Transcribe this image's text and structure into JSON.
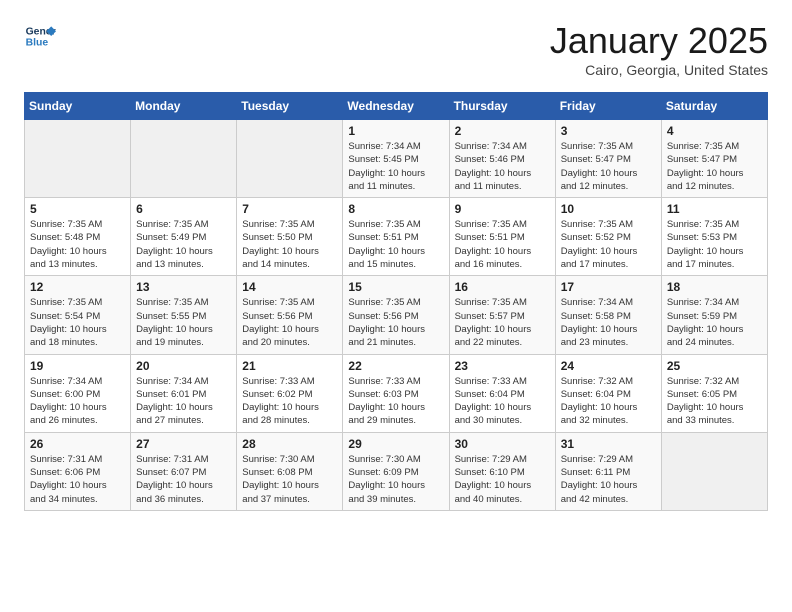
{
  "header": {
    "logo_line1": "General",
    "logo_line2": "Blue",
    "title": "January 2025",
    "subtitle": "Cairo, Georgia, United States"
  },
  "weekdays": [
    "Sunday",
    "Monday",
    "Tuesday",
    "Wednesday",
    "Thursday",
    "Friday",
    "Saturday"
  ],
  "weeks": [
    [
      {
        "day": "",
        "info": ""
      },
      {
        "day": "",
        "info": ""
      },
      {
        "day": "",
        "info": ""
      },
      {
        "day": "1",
        "info": "Sunrise: 7:34 AM\nSunset: 5:45 PM\nDaylight: 10 hours\nand 11 minutes."
      },
      {
        "day": "2",
        "info": "Sunrise: 7:34 AM\nSunset: 5:46 PM\nDaylight: 10 hours\nand 11 minutes."
      },
      {
        "day": "3",
        "info": "Sunrise: 7:35 AM\nSunset: 5:47 PM\nDaylight: 10 hours\nand 12 minutes."
      },
      {
        "day": "4",
        "info": "Sunrise: 7:35 AM\nSunset: 5:47 PM\nDaylight: 10 hours\nand 12 minutes."
      }
    ],
    [
      {
        "day": "5",
        "info": "Sunrise: 7:35 AM\nSunset: 5:48 PM\nDaylight: 10 hours\nand 13 minutes."
      },
      {
        "day": "6",
        "info": "Sunrise: 7:35 AM\nSunset: 5:49 PM\nDaylight: 10 hours\nand 13 minutes."
      },
      {
        "day": "7",
        "info": "Sunrise: 7:35 AM\nSunset: 5:50 PM\nDaylight: 10 hours\nand 14 minutes."
      },
      {
        "day": "8",
        "info": "Sunrise: 7:35 AM\nSunset: 5:51 PM\nDaylight: 10 hours\nand 15 minutes."
      },
      {
        "day": "9",
        "info": "Sunrise: 7:35 AM\nSunset: 5:51 PM\nDaylight: 10 hours\nand 16 minutes."
      },
      {
        "day": "10",
        "info": "Sunrise: 7:35 AM\nSunset: 5:52 PM\nDaylight: 10 hours\nand 17 minutes."
      },
      {
        "day": "11",
        "info": "Sunrise: 7:35 AM\nSunset: 5:53 PM\nDaylight: 10 hours\nand 17 minutes."
      }
    ],
    [
      {
        "day": "12",
        "info": "Sunrise: 7:35 AM\nSunset: 5:54 PM\nDaylight: 10 hours\nand 18 minutes."
      },
      {
        "day": "13",
        "info": "Sunrise: 7:35 AM\nSunset: 5:55 PM\nDaylight: 10 hours\nand 19 minutes."
      },
      {
        "day": "14",
        "info": "Sunrise: 7:35 AM\nSunset: 5:56 PM\nDaylight: 10 hours\nand 20 minutes."
      },
      {
        "day": "15",
        "info": "Sunrise: 7:35 AM\nSunset: 5:56 PM\nDaylight: 10 hours\nand 21 minutes."
      },
      {
        "day": "16",
        "info": "Sunrise: 7:35 AM\nSunset: 5:57 PM\nDaylight: 10 hours\nand 22 minutes."
      },
      {
        "day": "17",
        "info": "Sunrise: 7:34 AM\nSunset: 5:58 PM\nDaylight: 10 hours\nand 23 minutes."
      },
      {
        "day": "18",
        "info": "Sunrise: 7:34 AM\nSunset: 5:59 PM\nDaylight: 10 hours\nand 24 minutes."
      }
    ],
    [
      {
        "day": "19",
        "info": "Sunrise: 7:34 AM\nSunset: 6:00 PM\nDaylight: 10 hours\nand 26 minutes."
      },
      {
        "day": "20",
        "info": "Sunrise: 7:34 AM\nSunset: 6:01 PM\nDaylight: 10 hours\nand 27 minutes."
      },
      {
        "day": "21",
        "info": "Sunrise: 7:33 AM\nSunset: 6:02 PM\nDaylight: 10 hours\nand 28 minutes."
      },
      {
        "day": "22",
        "info": "Sunrise: 7:33 AM\nSunset: 6:03 PM\nDaylight: 10 hours\nand 29 minutes."
      },
      {
        "day": "23",
        "info": "Sunrise: 7:33 AM\nSunset: 6:04 PM\nDaylight: 10 hours\nand 30 minutes."
      },
      {
        "day": "24",
        "info": "Sunrise: 7:32 AM\nSunset: 6:04 PM\nDaylight: 10 hours\nand 32 minutes."
      },
      {
        "day": "25",
        "info": "Sunrise: 7:32 AM\nSunset: 6:05 PM\nDaylight: 10 hours\nand 33 minutes."
      }
    ],
    [
      {
        "day": "26",
        "info": "Sunrise: 7:31 AM\nSunset: 6:06 PM\nDaylight: 10 hours\nand 34 minutes."
      },
      {
        "day": "27",
        "info": "Sunrise: 7:31 AM\nSunset: 6:07 PM\nDaylight: 10 hours\nand 36 minutes."
      },
      {
        "day": "28",
        "info": "Sunrise: 7:30 AM\nSunset: 6:08 PM\nDaylight: 10 hours\nand 37 minutes."
      },
      {
        "day": "29",
        "info": "Sunrise: 7:30 AM\nSunset: 6:09 PM\nDaylight: 10 hours\nand 39 minutes."
      },
      {
        "day": "30",
        "info": "Sunrise: 7:29 AM\nSunset: 6:10 PM\nDaylight: 10 hours\nand 40 minutes."
      },
      {
        "day": "31",
        "info": "Sunrise: 7:29 AM\nSunset: 6:11 PM\nDaylight: 10 hours\nand 42 minutes."
      },
      {
        "day": "",
        "info": ""
      }
    ]
  ]
}
